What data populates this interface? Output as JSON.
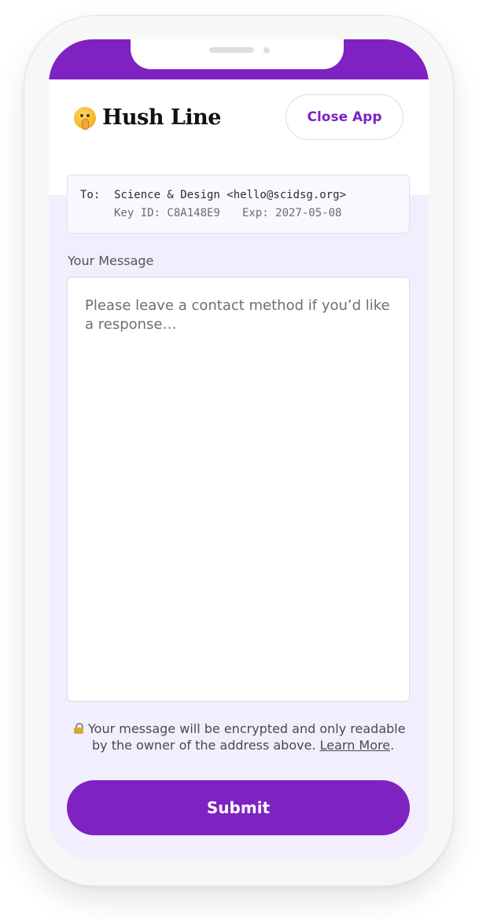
{
  "app": {
    "name": "Hush Line",
    "close_label": "Close App",
    "accent_color": "#7e22c2",
    "logo_icon": "shushing-face-icon"
  },
  "recipient": {
    "to_label": "To:",
    "name_email": "Science & Design <hello@scidsg.org>",
    "key_id": "Key ID: C8A148E9",
    "expires": "Exp: 2027-05-08"
  },
  "message": {
    "label": "Your Message",
    "placeholder": "Please leave a contact method if you’d like a response…",
    "value": ""
  },
  "notice": {
    "icon": "lock-icon",
    "text_line1": "Your message will be encrypted and only readable",
    "text_line2": "by the owner of the address above.",
    "link_label": "Learn More",
    "trailing": "."
  },
  "submit": {
    "label": "Submit"
  }
}
